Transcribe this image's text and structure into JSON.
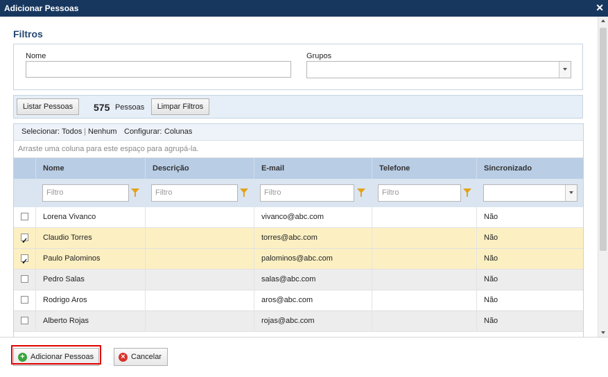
{
  "window": {
    "title": "Adicionar Pessoas",
    "close_glyph": "✕"
  },
  "filters": {
    "title": "Filtros",
    "name_label": "Nome",
    "name_value": "",
    "groups_label": "Grupos",
    "groups_value": ""
  },
  "toolbar": {
    "list_button": "Listar Pessoas",
    "count": "575",
    "count_label": "Pessoas",
    "clear_button": "Limpar Filtros"
  },
  "grid": {
    "select_label": "Selecionar:",
    "select_all": "Todos",
    "separator": "|",
    "select_none": "Nenhum",
    "configure_label": "Configurar:",
    "configure_columns": "Colunas",
    "group_hint": "Arraste uma coluna para este espaço para agrupá-la.",
    "columns": [
      "Nome",
      "Descrição",
      "E-mail",
      "Telefone",
      "Sincronizado"
    ],
    "filter_placeholder": "Filtro",
    "rows": [
      {
        "name": "Lorena Vivanco",
        "description": "",
        "email": "vivanco@abc.com",
        "phone": "",
        "synced": "Não",
        "checked": false
      },
      {
        "name": "Claudio Torres",
        "description": "",
        "email": "torres@abc.com",
        "phone": "",
        "synced": "Não",
        "checked": true
      },
      {
        "name": "Paulo Palominos",
        "description": "",
        "email": "palominos@abc.com",
        "phone": "",
        "synced": "Não",
        "checked": true
      },
      {
        "name": "Pedro Salas",
        "description": "",
        "email": "salas@abc.com",
        "phone": "",
        "synced": "Não",
        "checked": false
      },
      {
        "name": "Rodrigo Aros",
        "description": "",
        "email": "aros@abc.com",
        "phone": "",
        "synced": "Não",
        "checked": false
      },
      {
        "name": "Alberto Rojas",
        "description": "",
        "email": "rojas@abc.com",
        "phone": "",
        "synced": "Não",
        "checked": false
      }
    ]
  },
  "footer": {
    "add_button": "Adicionar Pessoas",
    "cancel_button": "Cancelar"
  },
  "colors": {
    "titlebar": "#17375e",
    "header": "#b9cde5",
    "selected_row": "#fcf0c3",
    "highlight": "#e00000"
  }
}
